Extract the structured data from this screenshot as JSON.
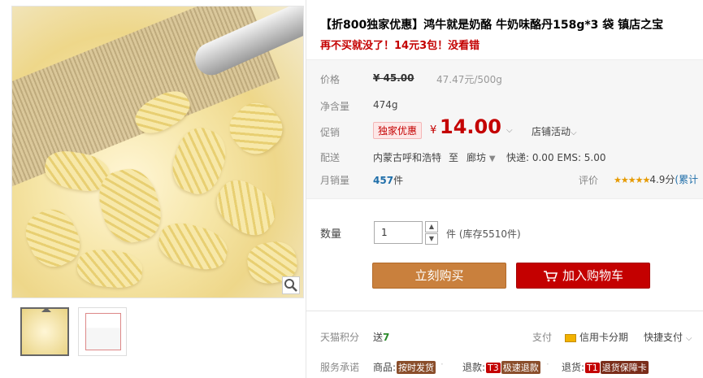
{
  "product": {
    "title": "【折800独家优惠】鸿牛就是奶酪 牛奶味酪丹158g*3 袋 镇店之宝",
    "subtitle": "再不买就没了！14元3包！没看错"
  },
  "price": {
    "label": "价格",
    "original": "¥ 45.00",
    "unit_price": "47.47元/500g"
  },
  "weight": {
    "label": "净含量",
    "value": "474g"
  },
  "promo": {
    "label": "促销",
    "tag": "独家优惠",
    "currency": "¥",
    "price": "14.00",
    "shop_activity": "店铺活动"
  },
  "shipping": {
    "label": "配送",
    "from": "内蒙古呼和浩特",
    "to_label": "至",
    "destination": "廊坊",
    "cost": "快递: 0.00 EMS: 5.00"
  },
  "sales": {
    "label": "月销量",
    "count": "457",
    "unit": "件"
  },
  "rating": {
    "label": "评价",
    "stars": "★★★★★",
    "score": "4.9分",
    "link": "(累计"
  },
  "quantity": {
    "label": "数量",
    "value": "1",
    "stock": "件 (库存5510件)"
  },
  "buttons": {
    "buy": "立刻购买",
    "cart": "加入购物车"
  },
  "points": {
    "label": "天猫积分",
    "send": "送",
    "value": "7"
  },
  "payment": {
    "label": "支付",
    "credit": "信用卡分期",
    "quick": "快捷支付"
  },
  "service": {
    "label": "服务承诺",
    "goods": "商品:",
    "goods_badge": "按时发货",
    "refund": "退款:",
    "refund_badge_code": "T3",
    "refund_badge": "极速退款",
    "return": "退货:",
    "return_badge_code": "T1",
    "return_badge": "退货保障卡"
  },
  "colors": {
    "accent": "#c40000",
    "buy_button": "#c9803d",
    "link": "#1f6ea9"
  }
}
